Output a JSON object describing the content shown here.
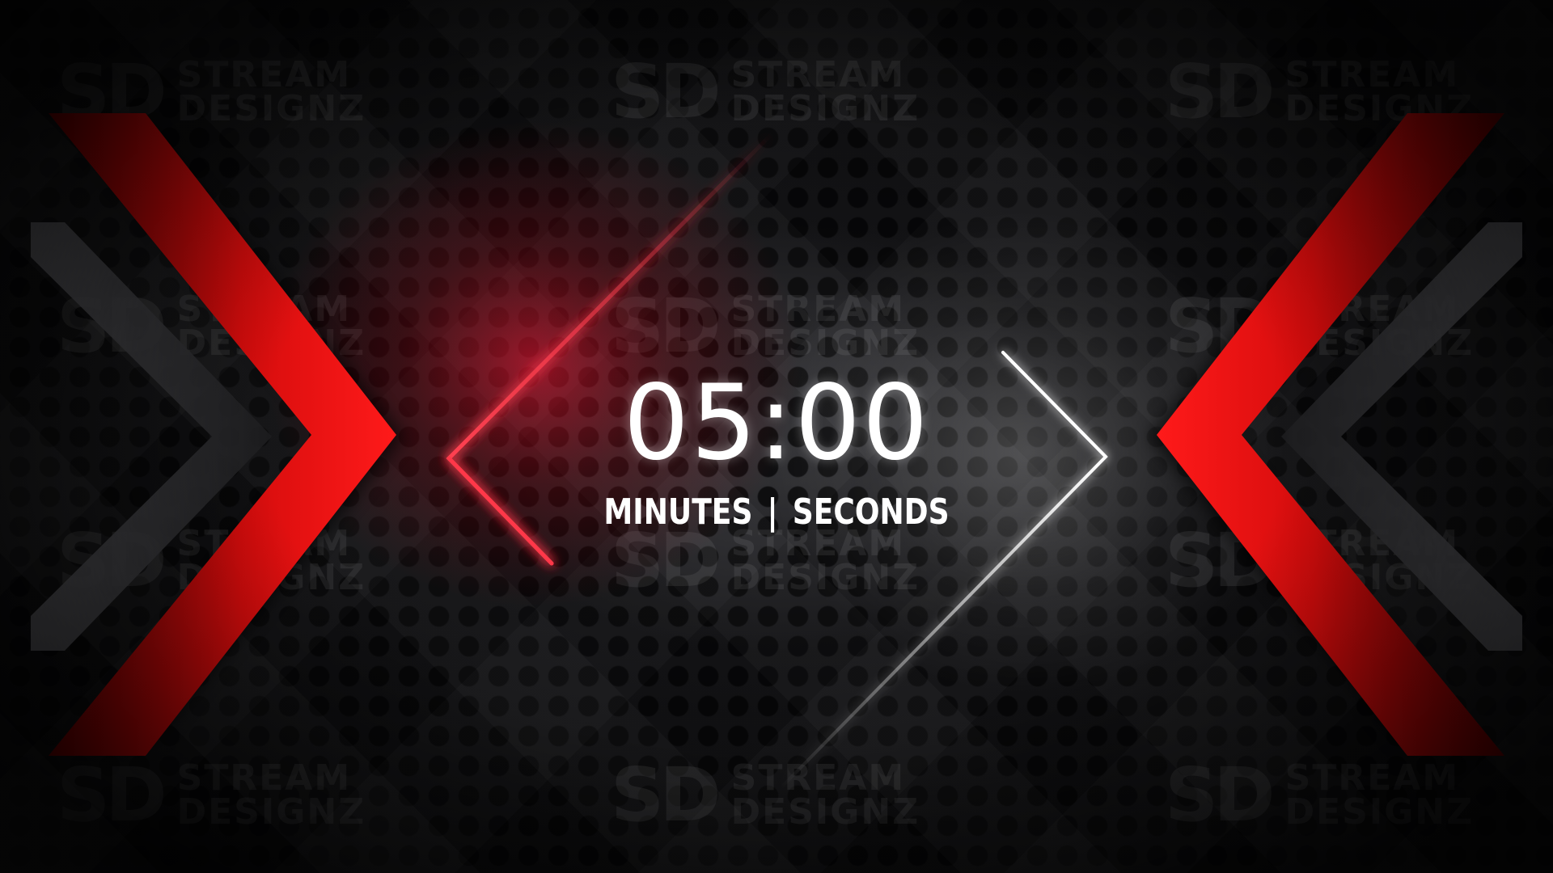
{
  "timer": {
    "value": "05:00",
    "minutes_label": "MINUTES",
    "separator": "|",
    "seconds_label": "SECONDS"
  },
  "watermark": {
    "logo": "SD",
    "line1": "STREAM",
    "line2": "DESIGNZ"
  },
  "colors": {
    "accent_red": "#e60f0f",
    "neon_red": "#ff2a3a",
    "neon_white": "#ffffff",
    "background": "#111113"
  }
}
